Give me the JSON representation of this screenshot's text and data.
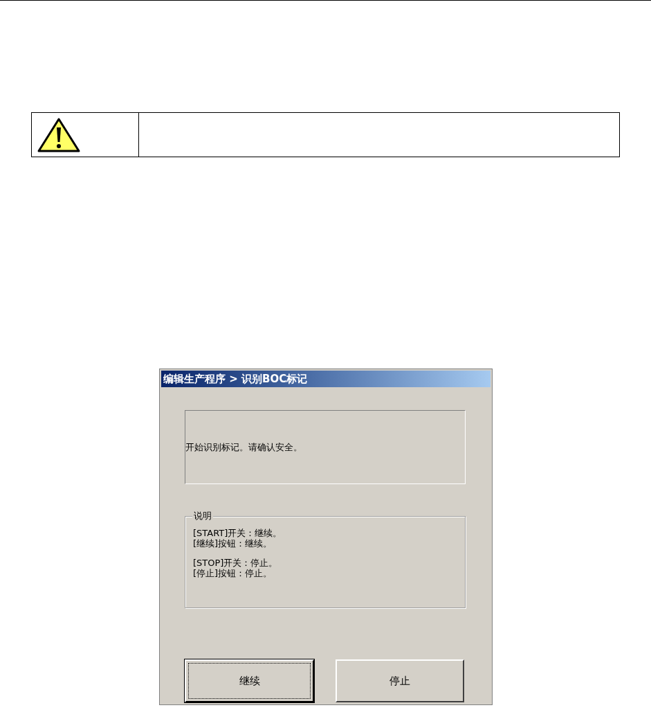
{
  "dialog": {
    "title": "编辑生产程序 > 识别BOC标记",
    "message": "开始识别标记。请确认安全。",
    "description": {
      "legend": "说明",
      "groups": [
        [
          "[START]开关：继续。",
          "[继续]按钮：继续。"
        ],
        [
          "[STOP]开关：停止。",
          "[停止]按钮：停止。"
        ]
      ]
    },
    "buttons": [
      {
        "label": "继续",
        "default": true
      },
      {
        "label": "停止",
        "default": false
      }
    ]
  }
}
